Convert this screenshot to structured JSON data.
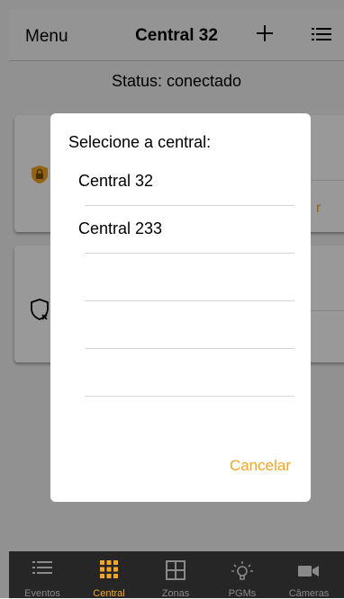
{
  "header": {
    "menu_label": "Menu",
    "title": "Central 32",
    "add_icon": "plus-icon",
    "list_icon": "list-icon"
  },
  "status": "Status: conectado",
  "cards": [
    {
      "icon": "lock-shield-icon",
      "partial_text": "r"
    },
    {
      "icon": "shield-off-icon"
    }
  ],
  "dialog": {
    "title": "Selecione a central:",
    "options": [
      "Central 32",
      "Central 233",
      "",
      "",
      ""
    ],
    "cancel_label": "Cancelar"
  },
  "tabs": [
    {
      "label": "Eventos",
      "icon": "list-icon",
      "active": false
    },
    {
      "label": "Central",
      "icon": "grid-icon",
      "active": true
    },
    {
      "label": "Zonas",
      "icon": "zones-grid-icon",
      "active": false
    },
    {
      "label": "PGMs",
      "icon": "lightbulb-icon",
      "active": false
    },
    {
      "label": "Câmeras",
      "icon": "camera-icon",
      "active": false
    }
  ],
  "colors": {
    "accent": "#f5a623",
    "tabbar_bg": "#262626",
    "inactive_tab": "#8a8a8a"
  }
}
